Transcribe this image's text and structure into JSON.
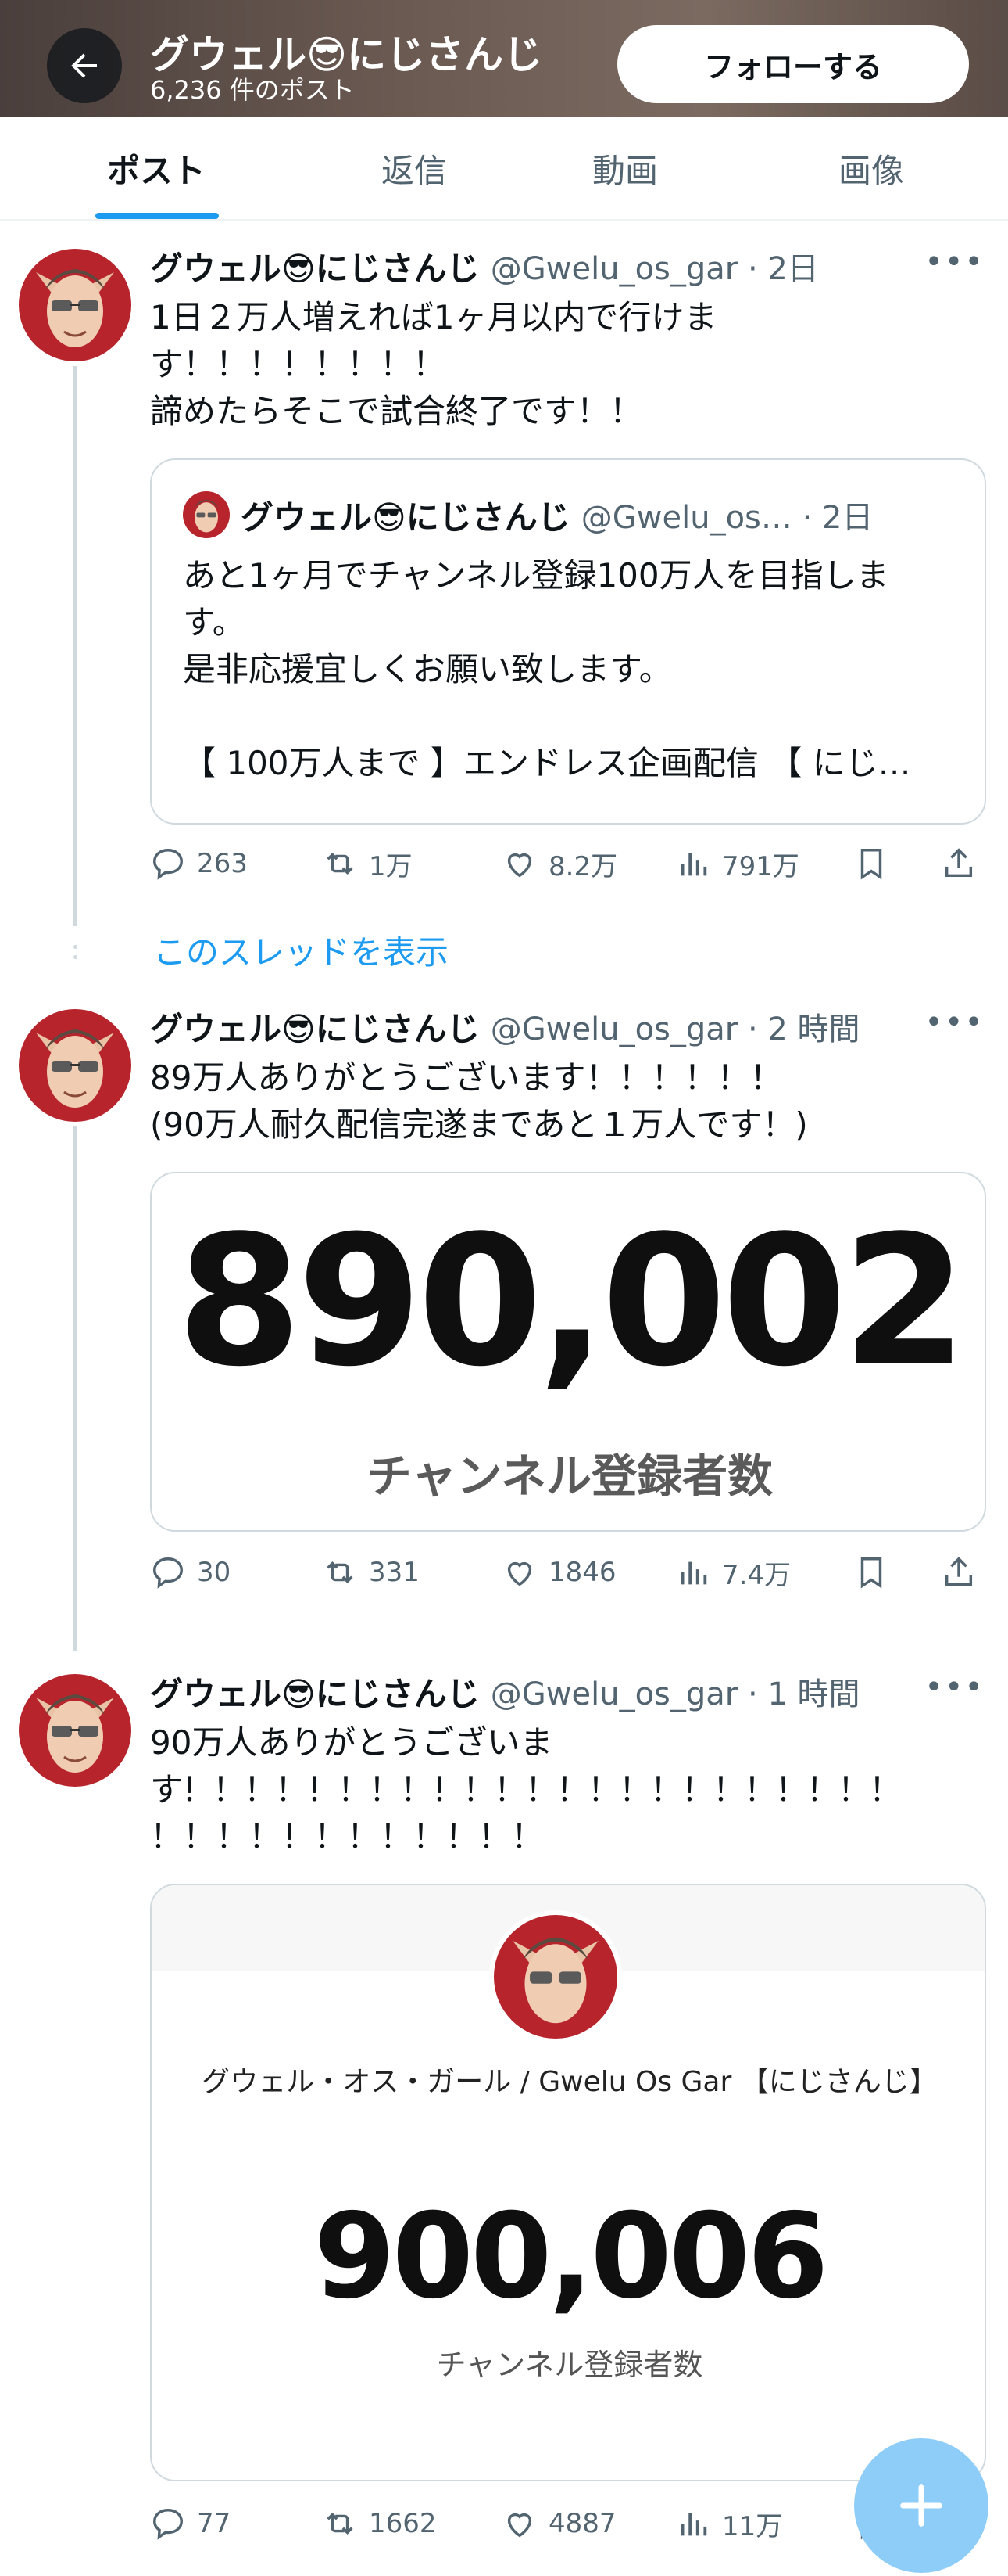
{
  "header": {
    "title": "グウェル😎にじさんじ",
    "post_count": "6,236 件のポスト",
    "follow_label": "フォローする"
  },
  "tabs": [
    {
      "label": "ポスト"
    },
    {
      "label": "返信"
    },
    {
      "label": "動画"
    },
    {
      "label": "画像"
    }
  ],
  "posts": [
    {
      "name": "グウェル😎にじさんじ",
      "handle": "@Gwelu_os_gar · 2日",
      "text_lines": [
        "1日２万人増えれば1ヶ月以内で行けま",
        "す！！！！！！！！",
        "諦めたらそこで試合終了です！！"
      ],
      "quote": {
        "name": "グウェル😎にじさんじ",
        "handle": "@Gwelu_os… · 2日",
        "text_lines": [
          "あと1ヶ月でチャンネル登録100万人を目指しま",
          "す。",
          "是非応援宜しくお願い致します。",
          "",
          "【 100万人まで 】エンドレス企画配信 【 にじ…"
        ]
      },
      "replies": "263",
      "reposts": "1万",
      "likes": "8.2万",
      "views": "791万"
    },
    {
      "name": "グウェル😎にじさんじ",
      "handle": "@Gwelu_os_gar · 2 時間",
      "text_lines": [
        "89万人ありがとうございます！！！！！！",
        "(90万人耐久配信完遂まであと１万人です！)"
      ],
      "media": {
        "count": "890,002",
        "caption": "チャンネル登録者数"
      },
      "replies": "30",
      "reposts": "331",
      "likes": "1846",
      "views": "7.4万"
    },
    {
      "name": "グウェル😎にじさんじ",
      "handle": "@Gwelu_os_gar · 1 時間",
      "text_lines": [
        "90万人ありがとうございま",
        "す！！！！！！！！！！！！！！！！！！！！！！！",
        "！！！！！！！！！！！！"
      ],
      "media": {
        "channel_name": "グウェル・オス・ガール / Gwelu Os Gar 【にじさんじ】",
        "count": "900,006",
        "caption": "チャンネル登録者数"
      },
      "replies": "77",
      "reposts": "1662",
      "likes": "4887",
      "views": "11万"
    }
  ],
  "show_thread": "このスレッドを表示",
  "colors": {
    "accent": "#1d9bf0",
    "muted": "#536471",
    "text": "#0f1419"
  }
}
